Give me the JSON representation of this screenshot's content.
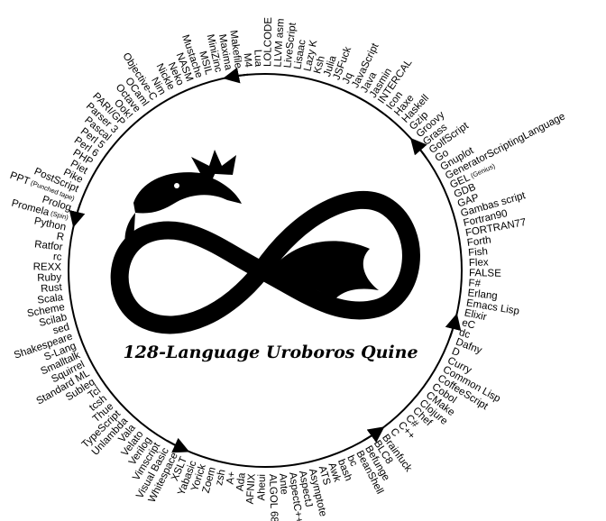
{
  "title": "128-Language Uroboros Quine",
  "colors": {
    "ink": "#000000",
    "background": "#ffffff"
  },
  "logo": {
    "icon": "uroboros-dragon-infinity-icon"
  },
  "languages": [
    {
      "name": "Ruby"
    },
    {
      "name": "Rust"
    },
    {
      "name": "Scala"
    },
    {
      "name": "Scheme"
    },
    {
      "name": "Scilab"
    },
    {
      "name": "sed"
    },
    {
      "name": "Shakespeare"
    },
    {
      "name": "S-Lang"
    },
    {
      "name": "Smalltalk"
    },
    {
      "name": "Squirrel"
    },
    {
      "name": "Standard ML"
    },
    {
      "name": "Subleq"
    },
    {
      "name": "Tcl"
    },
    {
      "name": "tcsh"
    },
    {
      "name": "Thue"
    },
    {
      "name": "TypeScript"
    },
    {
      "name": "Unlambda"
    },
    {
      "name": "Vala"
    },
    {
      "name": "Velato"
    },
    {
      "name": "Verilog"
    },
    {
      "name": "Vimscript"
    },
    {
      "name": "Visual Basic"
    },
    {
      "name": "Whitespace"
    },
    {
      "name": "XSLT"
    },
    {
      "name": "Yabasic"
    },
    {
      "name": "Yorick"
    },
    {
      "name": "Zoem"
    },
    {
      "name": "zsh"
    },
    {
      "name": "A+"
    },
    {
      "name": "Ada"
    },
    {
      "name": "AFNIX"
    },
    {
      "name": "Aheui"
    },
    {
      "name": "ALGOL 68"
    },
    {
      "name": "Ante"
    },
    {
      "name": "AspectC++"
    },
    {
      "name": "AspectJ"
    },
    {
      "name": "Asymptote"
    },
    {
      "name": "ATS"
    },
    {
      "name": "Awk"
    },
    {
      "name": "bash"
    },
    {
      "name": "bc"
    },
    {
      "name": "BeanShell"
    },
    {
      "name": "Befunge"
    },
    {
      "name": "BLC8"
    },
    {
      "name": "Brainfuck"
    },
    {
      "name": "C"
    },
    {
      "name": "C++"
    },
    {
      "name": "C#"
    },
    {
      "name": "Chef"
    },
    {
      "name": "Clojure"
    },
    {
      "name": "CMake"
    },
    {
      "name": "Cobol"
    },
    {
      "name": "CoffeeScript"
    },
    {
      "name": "Common Lisp"
    },
    {
      "name": "Curry"
    },
    {
      "name": "D"
    },
    {
      "name": "Dafny"
    },
    {
      "name": "dc"
    },
    {
      "name": "eC"
    },
    {
      "name": "Elixir"
    },
    {
      "name": "Emacs Lisp"
    },
    {
      "name": "Erlang"
    },
    {
      "name": "F#"
    },
    {
      "name": "FALSE"
    },
    {
      "name": "Flex"
    },
    {
      "name": "Fish"
    },
    {
      "name": "Forth"
    },
    {
      "name": "FORTRAN77"
    },
    {
      "name": "Fortran90"
    },
    {
      "name": "Gambas script"
    },
    {
      "name": "GAP"
    },
    {
      "name": "GDB"
    },
    {
      "name": "GEL",
      "sub": "(Genius)"
    },
    {
      "name": "GeneratorScriptingLanguage"
    },
    {
      "name": "Gnuplot"
    },
    {
      "name": "Go"
    },
    {
      "name": "GolfScript"
    },
    {
      "name": "Grass"
    },
    {
      "name": "Groovy"
    },
    {
      "name": "Gzip"
    },
    {
      "name": "Haskell"
    },
    {
      "name": "Haxe"
    },
    {
      "name": "Icon"
    },
    {
      "name": "INTERCAL"
    },
    {
      "name": "Jasmin"
    },
    {
      "name": "Java"
    },
    {
      "name": "JavaScript"
    },
    {
      "name": "Jq"
    },
    {
      "name": "JSFuck"
    },
    {
      "name": "Julia"
    },
    {
      "name": "Ksh"
    },
    {
      "name": "Lazy K"
    },
    {
      "name": "Lisaac"
    },
    {
      "name": "LiveScript"
    },
    {
      "name": "LLVM asm"
    },
    {
      "name": "LOLCODE"
    },
    {
      "name": "Lua"
    },
    {
      "name": "M4"
    },
    {
      "name": "Makefile"
    },
    {
      "name": "Maxima"
    },
    {
      "name": "MiniZinc"
    },
    {
      "name": "MSIL"
    },
    {
      "name": "Mustache"
    },
    {
      "name": "NASM"
    },
    {
      "name": "Neko"
    },
    {
      "name": "Nickle"
    },
    {
      "name": "Nim"
    },
    {
      "name": "Objective-C"
    },
    {
      "name": "OCaml"
    },
    {
      "name": "Octave"
    },
    {
      "name": "Ook!"
    },
    {
      "name": "PARI/GP"
    },
    {
      "name": "Parser 3"
    },
    {
      "name": "Pascal"
    },
    {
      "name": "Perl 5"
    },
    {
      "name": "Perl 6"
    },
    {
      "name": "PHP"
    },
    {
      "name": "Piet"
    },
    {
      "name": "Pike"
    },
    {
      "name": "PostScript"
    },
    {
      "name": "PPT",
      "sub": "(Punched tape)"
    },
    {
      "name": "Prolog"
    },
    {
      "name": "Promela",
      "sub": "(Spin)"
    },
    {
      "name": "Python"
    },
    {
      "name": "R"
    },
    {
      "name": "Ratfor"
    },
    {
      "name": "rc"
    },
    {
      "name": "REXX"
    }
  ]
}
